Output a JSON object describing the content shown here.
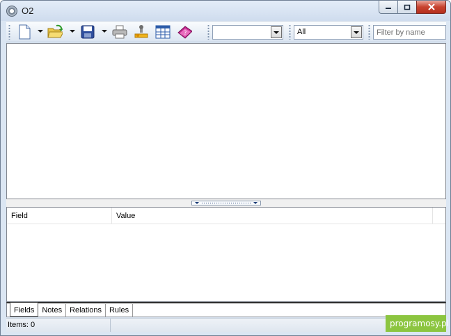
{
  "window": {
    "title": "O2"
  },
  "toolbar": {
    "icons": [
      "new-document-icon",
      "open-folder-icon",
      "save-disk-icon",
      "print-icon",
      "tools-joystick-icon",
      "table-view-icon",
      "help-book-icon"
    ],
    "combo1_value": "",
    "combo2_value": "All",
    "filter_placeholder": "Filter by name"
  },
  "details": {
    "columns": [
      "Field",
      "Value"
    ]
  },
  "tabs": [
    "Fields",
    "Notes",
    "Relations",
    "Rules"
  ],
  "status": {
    "items_text": "Items: 0"
  },
  "watermark": {
    "text": "programosy.pl"
  },
  "colors": {
    "frame": "#dbe6f3",
    "close_button": "#c7432f",
    "watermark_bg": "#8cc540"
  }
}
